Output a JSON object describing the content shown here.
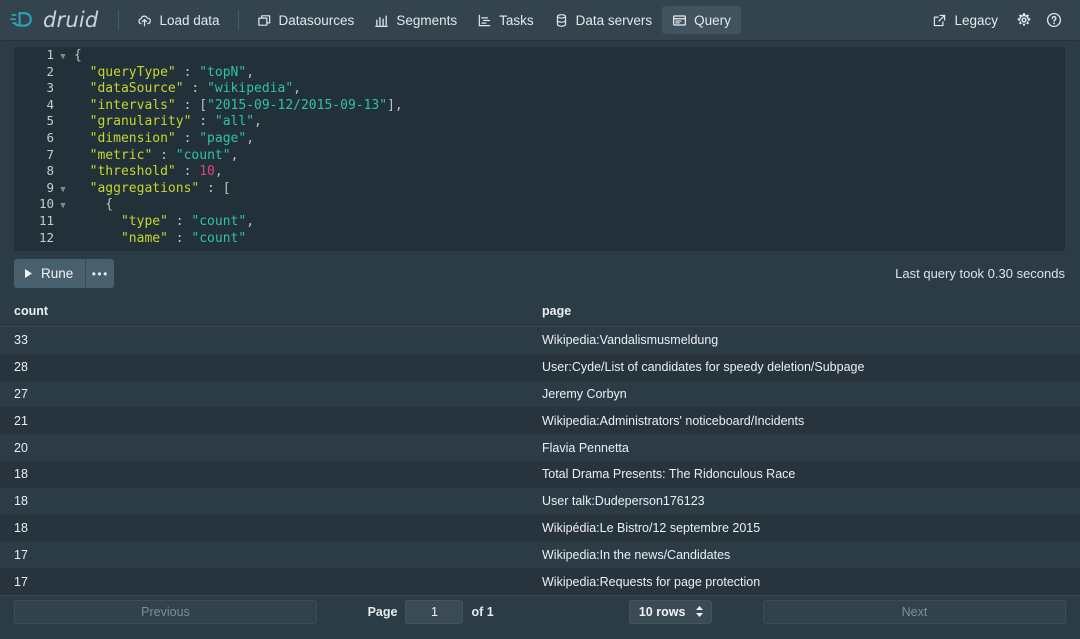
{
  "navbar": {
    "brand": "druid",
    "brand_icon": "druid-logo-icon",
    "items": [
      {
        "label": "Load data",
        "icon": "cloud-upload-icon",
        "active": false
      },
      {
        "label": "Datasources",
        "icon": "layers-icon",
        "active": false
      },
      {
        "label": "Segments",
        "icon": "bar-chart-icon",
        "active": false
      },
      {
        "label": "Tasks",
        "icon": "gantt-chart-icon",
        "active": false
      },
      {
        "label": "Data servers",
        "icon": "database-icon",
        "active": false
      },
      {
        "label": "Query",
        "icon": "application-icon",
        "active": true
      }
    ],
    "legacy_label": "Legacy",
    "legacy_icon": "share-external-icon",
    "settings_icon": "gear-icon",
    "help_icon": "help-icon"
  },
  "editor": {
    "lines": [
      {
        "num": "1",
        "fold": true,
        "tokens": [
          {
            "t": "{",
            "c": "p"
          }
        ]
      },
      {
        "num": "2",
        "fold": false,
        "tokens": [
          {
            "t": "  \"queryType\"",
            "c": "k"
          },
          {
            "t": " : ",
            "c": "p"
          },
          {
            "t": "\"topN\"",
            "c": "s"
          },
          {
            "t": ",",
            "c": "p"
          }
        ]
      },
      {
        "num": "3",
        "fold": false,
        "tokens": [
          {
            "t": "  \"dataSource\"",
            "c": "k"
          },
          {
            "t": " : ",
            "c": "p"
          },
          {
            "t": "\"wikipedia\"",
            "c": "s"
          },
          {
            "t": ",",
            "c": "p"
          }
        ]
      },
      {
        "num": "4",
        "fold": false,
        "tokens": [
          {
            "t": "  \"intervals\"",
            "c": "k"
          },
          {
            "t": " : [",
            "c": "p"
          },
          {
            "t": "\"2015-09-12/2015-09-13\"",
            "c": "s"
          },
          {
            "t": "],",
            "c": "p"
          }
        ]
      },
      {
        "num": "5",
        "fold": false,
        "tokens": [
          {
            "t": "  \"granularity\"",
            "c": "k"
          },
          {
            "t": " : ",
            "c": "p"
          },
          {
            "t": "\"all\"",
            "c": "s"
          },
          {
            "t": ",",
            "c": "p"
          }
        ]
      },
      {
        "num": "6",
        "fold": false,
        "tokens": [
          {
            "t": "  \"dimension\"",
            "c": "k"
          },
          {
            "t": " : ",
            "c": "p"
          },
          {
            "t": "\"page\"",
            "c": "s"
          },
          {
            "t": ",",
            "c": "p"
          }
        ]
      },
      {
        "num": "7",
        "fold": false,
        "tokens": [
          {
            "t": "  \"metric\"",
            "c": "k"
          },
          {
            "t": " : ",
            "c": "p"
          },
          {
            "t": "\"count\"",
            "c": "s"
          },
          {
            "t": ",",
            "c": "p"
          }
        ]
      },
      {
        "num": "8",
        "fold": false,
        "tokens": [
          {
            "t": "  \"threshold\"",
            "c": "k"
          },
          {
            "t": " : ",
            "c": "p"
          },
          {
            "t": "10",
            "c": "n"
          },
          {
            "t": ",",
            "c": "p"
          }
        ]
      },
      {
        "num": "9",
        "fold": true,
        "tokens": [
          {
            "t": "  \"aggregations\"",
            "c": "k"
          },
          {
            "t": " : [",
            "c": "p"
          }
        ]
      },
      {
        "num": "10",
        "fold": true,
        "tokens": [
          {
            "t": "    {",
            "c": "p"
          }
        ]
      },
      {
        "num": "11",
        "fold": false,
        "tokens": [
          {
            "t": "      \"type\"",
            "c": "k"
          },
          {
            "t": " : ",
            "c": "p"
          },
          {
            "t": "\"count\"",
            "c": "s"
          },
          {
            "t": ",",
            "c": "p"
          }
        ]
      },
      {
        "num": "12",
        "fold": false,
        "tokens": [
          {
            "t": "      \"name\"",
            "c": "k"
          },
          {
            "t": " : ",
            "c": "p"
          },
          {
            "t": "\"count\"",
            "c": "s"
          }
        ]
      }
    ]
  },
  "toolbar": {
    "run_label": "Rune",
    "run_icon": "play-icon",
    "more_label": "•••",
    "query_time": "Last query took 0.30 seconds"
  },
  "results": {
    "columns": [
      "count",
      "page"
    ],
    "rows": [
      {
        "count": "33",
        "page": "Wikipedia:Vandalismusmeldung"
      },
      {
        "count": "28",
        "page": "User:Cyde/List of candidates for speedy deletion/Subpage"
      },
      {
        "count": "27",
        "page": "Jeremy Corbyn"
      },
      {
        "count": "21",
        "page": "Wikipedia:Administrators' noticeboard/Incidents"
      },
      {
        "count": "20",
        "page": "Flavia Pennetta"
      },
      {
        "count": "18",
        "page": "Total Drama Presents: The Ridonculous Race"
      },
      {
        "count": "18",
        "page": "User talk:Dudeperson176123"
      },
      {
        "count": "18",
        "page": "Wikipédia:Le Bistro/12 septembre 2015"
      },
      {
        "count": "17",
        "page": "Wikipedia:In the news/Candidates"
      },
      {
        "count": "17",
        "page": "Wikipedia:Requests for page protection"
      }
    ]
  },
  "pagination": {
    "previous_label": "Previous",
    "next_label": "Next",
    "page_label": "Page",
    "page_value": "1",
    "of_label": "of 1",
    "rows_label": "10 rows",
    "rows_icon": "double-caret-vertical-icon"
  },
  "colors": {
    "navbar_bg": "#33444f",
    "page_bg": "#2c3c46",
    "editor_bg": "#22303a",
    "accent_teal": "#29a3b5",
    "key": "#c3d82c",
    "string": "#2fc2a8",
    "number": "#e0457b"
  }
}
